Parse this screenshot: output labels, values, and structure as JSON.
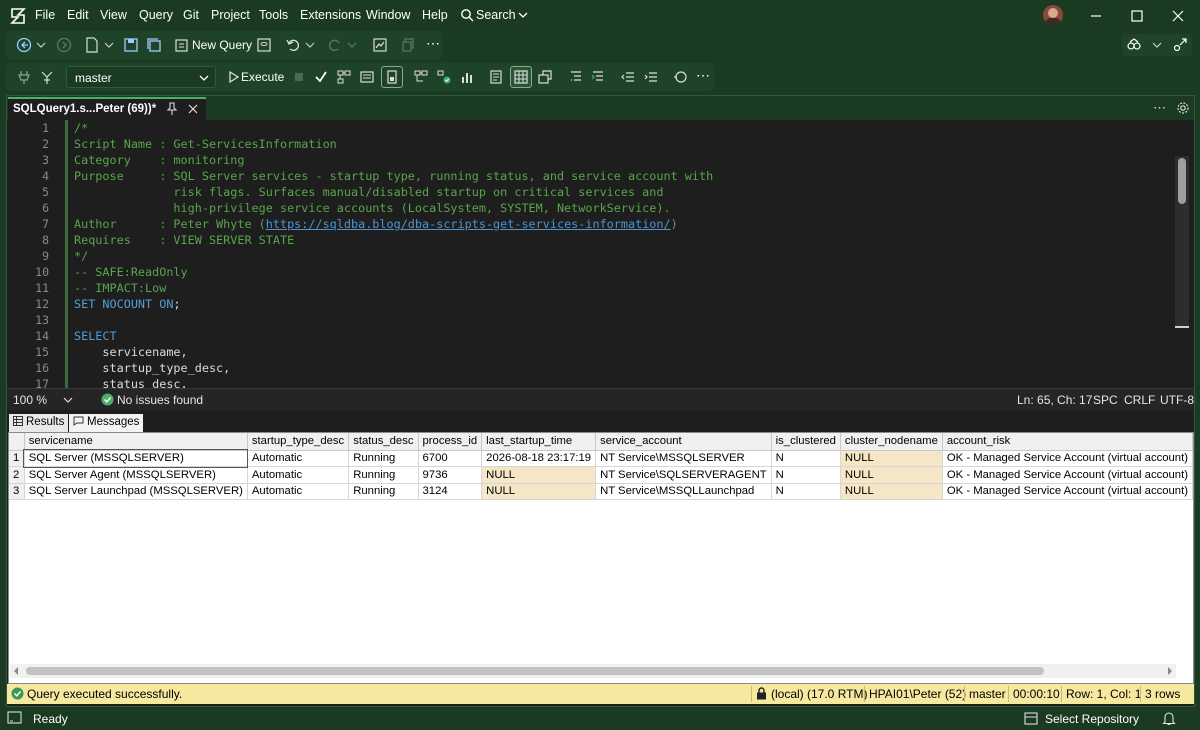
{
  "menu": [
    "File",
    "Edit",
    "View",
    "Query",
    "Git",
    "Project",
    "Tools",
    "Extensions",
    "Window",
    "Help"
  ],
  "search_label": "Search",
  "toolbar": {
    "new_query": "New Query",
    "database": "master",
    "execute": "Execute"
  },
  "tab": {
    "title": "SQLQuery1.s...Peter (69))*"
  },
  "editor": {
    "line_numbers": [
      "1",
      "2",
      "3",
      "4",
      "5",
      "6",
      "7",
      "8",
      "9",
      "10",
      "11",
      "12",
      "13",
      "14",
      "15",
      "16",
      "17"
    ],
    "lines": [
      {
        "segments": [
          {
            "t": "/*",
            "c": "c-comment"
          }
        ]
      },
      {
        "segments": [
          {
            "t": "Script Name : Get-ServicesInformation",
            "c": "c-comment"
          }
        ]
      },
      {
        "segments": [
          {
            "t": "Category    : monitoring",
            "c": "c-comment"
          }
        ]
      },
      {
        "segments": [
          {
            "t": "Purpose     : SQL Server services - startup type, running status, and service account with",
            "c": "c-comment"
          }
        ]
      },
      {
        "segments": [
          {
            "t": "              risk flags. Surfaces manual/disabled startup on critical services and",
            "c": "c-comment"
          }
        ]
      },
      {
        "segments": [
          {
            "t": "              high-privilege service accounts (LocalSystem, SYSTEM, NetworkService).",
            "c": "c-comment"
          }
        ]
      },
      {
        "segments": [
          {
            "t": "Author      : Peter Whyte (",
            "c": "c-comment"
          },
          {
            "t": "https://sqldba.blog/dba-scripts-get-services-information/",
            "c": "c-link"
          },
          {
            "t": ")",
            "c": "c-comment"
          }
        ]
      },
      {
        "segments": [
          {
            "t": "Requires    : VIEW SERVER STATE",
            "c": "c-comment"
          }
        ]
      },
      {
        "segments": [
          {
            "t": "*/",
            "c": "c-comment"
          }
        ]
      },
      {
        "segments": [
          {
            "t": "-- SAFE:ReadOnly",
            "c": "c-comment"
          }
        ]
      },
      {
        "segments": [
          {
            "t": "-- IMPACT:Low",
            "c": "c-comment"
          }
        ]
      },
      {
        "segments": [
          {
            "t": "SET NOCOUNT ON",
            "c": "c-kw"
          },
          {
            "t": ";",
            "c": "c-id"
          }
        ]
      },
      {
        "segments": [
          {
            "t": "",
            "c": "c-id"
          }
        ]
      },
      {
        "segments": [
          {
            "t": "SELECT",
            "c": "c-kw"
          }
        ]
      },
      {
        "segments": [
          {
            "t": "    servicename,",
            "c": "c-id"
          }
        ]
      },
      {
        "segments": [
          {
            "t": "    startup_type_desc,",
            "c": "c-id"
          }
        ]
      },
      {
        "segments": [
          {
            "t": "    status_desc,",
            "c": "c-id"
          }
        ]
      }
    ]
  },
  "editor_status": {
    "zoom": "100 %",
    "issues": "No issues found",
    "position": "Ln: 65, Ch: 17",
    "spc": "SPC",
    "crlf": "CRLF",
    "encoding": "UTF-8"
  },
  "results_tabs": [
    "Results",
    "Messages"
  ],
  "grid": {
    "columns": [
      "servicename",
      "startup_type_desc",
      "status_desc",
      "process_id",
      "last_startup_time",
      "service_account",
      "is_clustered",
      "cluster_nodename",
      "account_risk"
    ],
    "rows": [
      [
        "1",
        "SQL Server (MSSQLSERVER)",
        "Automatic",
        "Running",
        "6700",
        "2026-08-18 23:17:19",
        "NT Service\\MSSQLSERVER",
        "N",
        "NULL",
        "OK - Managed Service Account (virtual account)"
      ],
      [
        "2",
        "SQL Server Agent (MSSQLSERVER)",
        "Automatic",
        "Running",
        "9736",
        "NULL",
        "NT Service\\SQLSERVERAGENT",
        "N",
        "NULL",
        "OK - Managed Service Account (virtual account)"
      ],
      [
        "3",
        "SQL Server Launchpad (MSSQLSERVER)",
        "Automatic",
        "Running",
        "3124",
        "NULL",
        "NT Service\\MSSQLLaunchpad",
        "N",
        "NULL",
        "OK - Managed Service Account (virtual account)"
      ]
    ]
  },
  "query_status": {
    "message": "Query executed successfully.",
    "server": "(local) (17.0 RTM)",
    "user": "HPAI01\\Peter (52)",
    "database": "master",
    "elapsed": "00:00:10",
    "cursor": "Row: 1, Col: 1",
    "rows": "3 rows"
  },
  "app_status": {
    "ready": "Ready",
    "repo": "Select Repository"
  },
  "colors": {
    "chrome": "#1a3a22",
    "editor_bg": "#1e1e1e",
    "comment": "#57a64a",
    "keyword": "#569cd6",
    "status_yellow": "#f7e8a0",
    "null_cell": "#f5e6c6"
  }
}
